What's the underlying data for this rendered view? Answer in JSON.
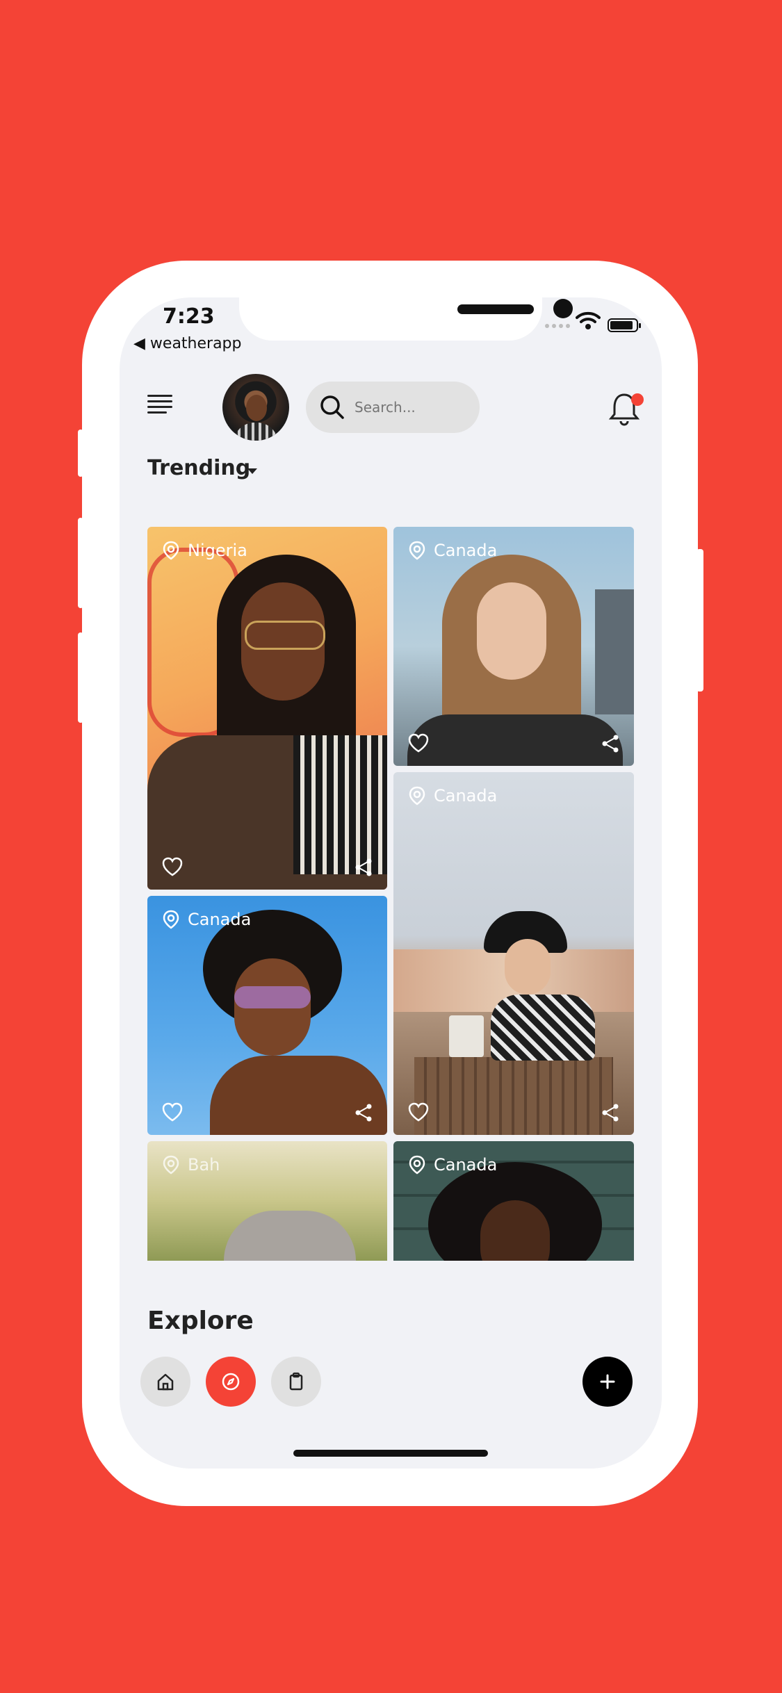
{
  "status_bar": {
    "time": "7:23",
    "back_app": "◀ weatherapp"
  },
  "header": {
    "search_placeholder": "Search..."
  },
  "section": {
    "trending_label": "Trending",
    "explore_label": "Explore"
  },
  "cards": [
    {
      "location": "Nigeria"
    },
    {
      "location": "Canada"
    },
    {
      "location": "Canada"
    },
    {
      "location": "Canada"
    },
    {
      "location": "Bah"
    },
    {
      "location": "Canada"
    }
  ],
  "colors": {
    "background": "#F44336",
    "accent": "#F44336",
    "screen": "#F1F2F6"
  },
  "icons": [
    "menu-icon",
    "search-icon",
    "bell-icon",
    "location-pin-icon",
    "heart-icon",
    "share-icon",
    "home-icon",
    "compass-icon",
    "clipboard-icon",
    "plus-icon"
  ]
}
